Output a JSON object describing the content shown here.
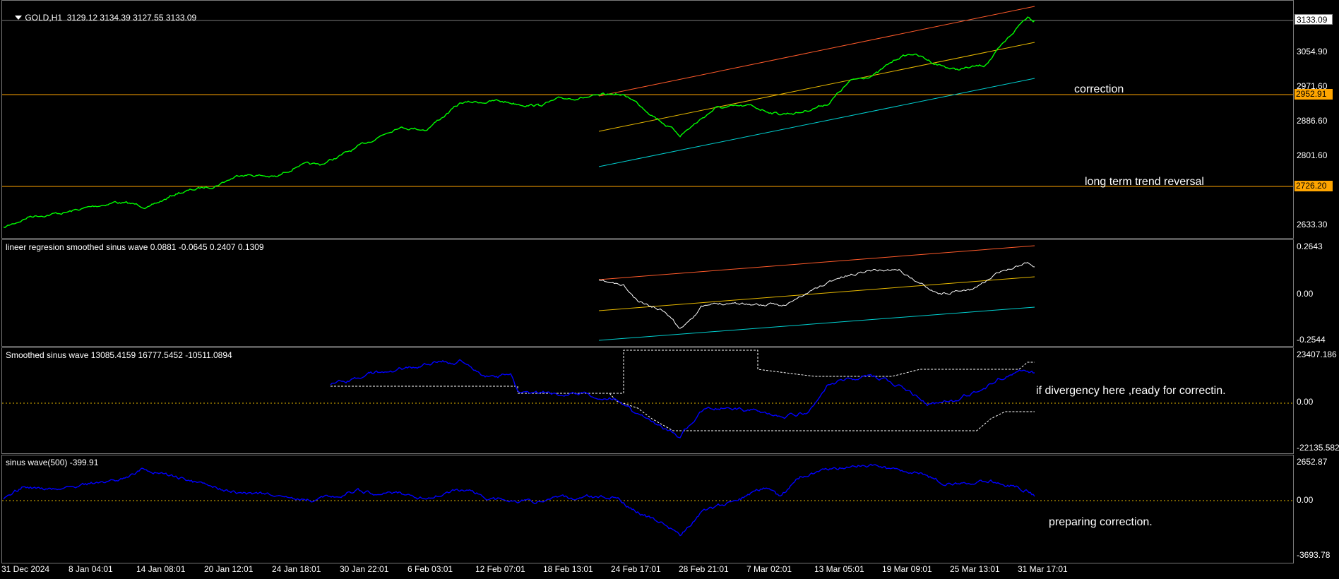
{
  "colors": {
    "price": "#00ff00",
    "upper": "#ff5a2a",
    "mid": "#e6b800",
    "lower": "#00d0d0",
    "blue": "#0000ff",
    "white": "#ffffff",
    "hline": "#ffa500"
  },
  "panes": [
    {
      "label": "GOLD,H1  3129.12 3134.39 3127.55 3133.09",
      "ticks": [
        "3054.90",
        "2971.60",
        "2886.60",
        "2801.60",
        "2633.30"
      ],
      "tags": [
        {
          "text": "3133.09",
          "style": "current"
        },
        {
          "text": "2952.91",
          "style": "level"
        },
        {
          "text": "2726.20",
          "style": "level"
        }
      ],
      "annotations": [
        "correction",
        "long term trend reversal"
      ],
      "icon": "dropdown-triangle-icon"
    },
    {
      "label": "lineer regresion smoothed sinus wave 0.0881 -0.0645 0.2407 0.1309",
      "ticks": [
        "0.2643",
        "0.00",
        "-0.2544"
      ]
    },
    {
      "label": "Smoothed sinus wave 13085.4159 16777.5452 -10511.0894",
      "ticks": [
        "23407.186",
        "0.00",
        "-22135.582"
      ],
      "annotations": [
        "if divergency here ,ready for correctin."
      ]
    },
    {
      "label": "sinus wave(500) -399.91",
      "ticks": [
        "2652.87",
        "0.00",
        "-3693.78"
      ],
      "annotations": [
        "preparing correction."
      ]
    }
  ],
  "time_axis": [
    "31 Dec 2024",
    "8 Jan 04:01",
    "14 Jan 08:01",
    "20 Jan 12:01",
    "24 Jan 18:01",
    "30 Jan 22:01",
    "6 Feb 03:01",
    "12 Feb 07:01",
    "18 Feb 13:01",
    "24 Feb 17:01",
    "28 Feb 21:01",
    "7 Mar 02:01",
    "13 Mar 05:01",
    "19 Mar 09:01",
    "25 Mar 13:01",
    "31 Mar 17:01"
  ]
}
